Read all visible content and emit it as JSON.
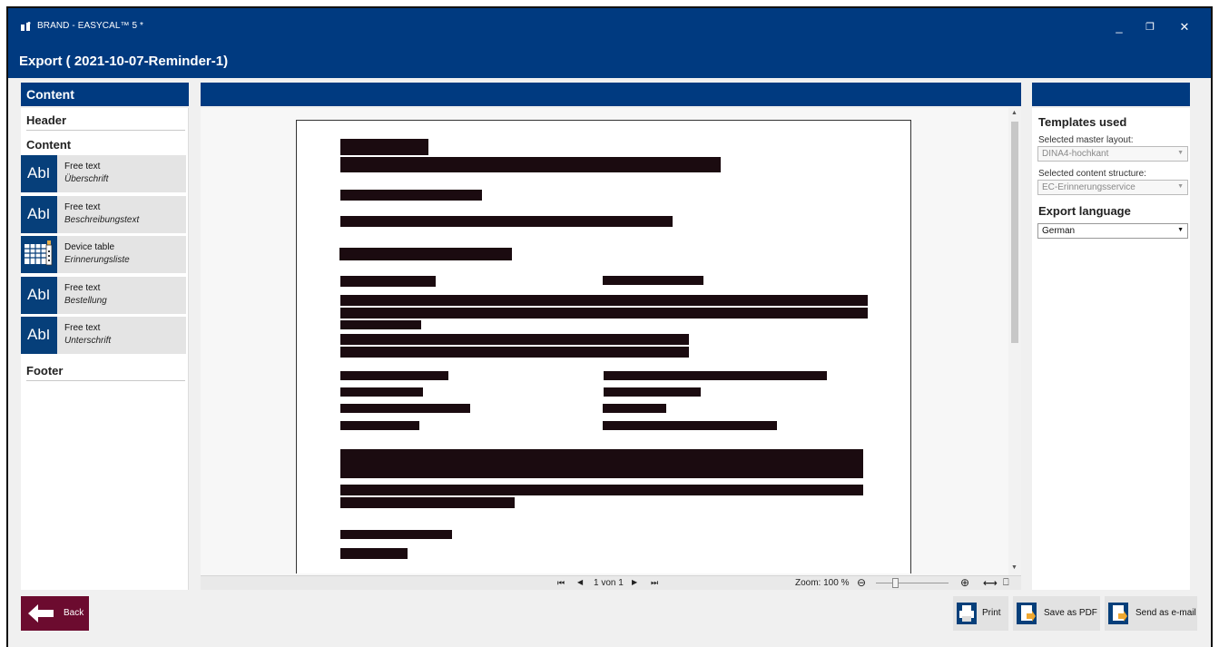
{
  "window": {
    "app_title": "BRAND - EASYCAL™ 5 *",
    "minimize": "_",
    "restore": "❐",
    "close": "✕"
  },
  "header": {
    "title": "Export ( 2021-10-07-Reminder-1)"
  },
  "left_panel": {
    "title": "Content",
    "header_label": "Header",
    "content_label": "Content",
    "footer_label": "Footer",
    "items": [
      {
        "icon": "text-icon",
        "icon_text": "Ab",
        "title": "Free text",
        "subtitle": "Überschrift"
      },
      {
        "icon": "text-icon",
        "icon_text": "Ab",
        "title": "Free text",
        "subtitle": "Beschreibungstext"
      },
      {
        "icon": "device-table-icon",
        "icon_text": "",
        "title": "Device table",
        "subtitle": "Erinnerungsliste"
      },
      {
        "icon": "text-icon",
        "icon_text": "Ab",
        "title": "Free text",
        "subtitle": "Bestellung"
      },
      {
        "icon": "text-icon",
        "icon_text": "Ab",
        "title": "Free text",
        "subtitle": "Unterschrift"
      }
    ]
  },
  "preview": {
    "page_first": "⏮",
    "page_prev": "◀",
    "page_info": "1 von 1",
    "page_next": "▶",
    "page_last": "⏭",
    "zoom_label": "Zoom: 100 %",
    "zoom_level": 0.25,
    "zoom_out": "⊖",
    "zoom_in": "⊕",
    "fit_width": "⟷",
    "fit_page": "⎕"
  },
  "right_panel": {
    "templates_title": "Templates used",
    "master_layout_label": "Selected master layout:",
    "master_layout_value": "DINA4-hochkant",
    "content_structure_label": "Selected content structure:",
    "content_structure_value": "EC-Erinnerungsservice",
    "export_language_title": "Export language",
    "export_language_value": "German"
  },
  "footer": {
    "back": "Back",
    "print": "Print",
    "save_pdf": "Save as PDF",
    "send_email": "Send as e-mail"
  },
  "colors": {
    "brand_blue": "#003a80",
    "back_button": "#6c0b2f",
    "redaction": "#1b0b10"
  }
}
